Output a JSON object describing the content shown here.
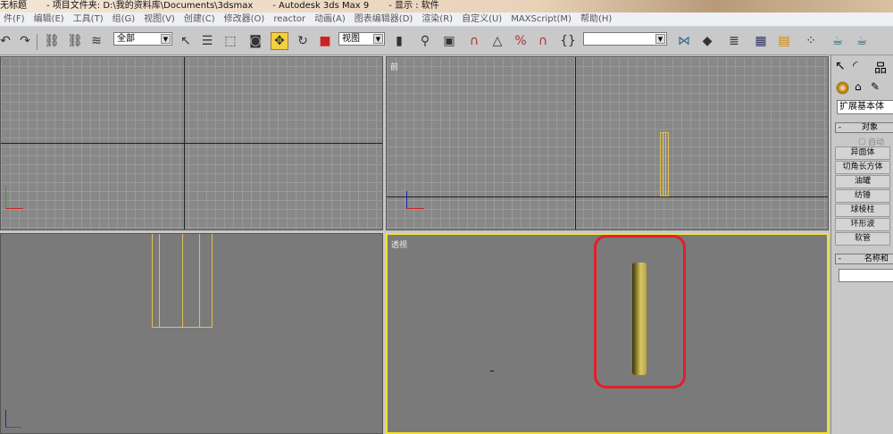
{
  "title": {
    "doc": "无标题",
    "project": "- 项目文件夹: D:\\我的资料库\\Documents\\3dsmax",
    "app": "- Autodesk 3ds Max 9",
    "display": "- 显示 : 软件"
  },
  "menu": [
    "件(F)",
    "编辑(E)",
    "工具(T)",
    "组(G)",
    "视图(V)",
    "创建(C)",
    "修改器(O)",
    "reactor",
    "动画(A)",
    "图表编辑器(D)",
    "渲染(R)",
    "自定义(U)",
    "MAXScript(M)",
    "帮助(H)"
  ],
  "toolbar": {
    "selection_filter": "全部",
    "reference_coord": "视图",
    "named_selection": ""
  },
  "viewports": {
    "top_right_label": "前",
    "bottom_right_label": "透视"
  },
  "panel": {
    "category": "扩展基本体",
    "object_type_header": "对象",
    "auto_grid": "自动",
    "buttons": [
      "异面体",
      "切角长方体",
      "油罐",
      "纺锤",
      "球棱柱",
      "环形波",
      "软管"
    ],
    "name_color_header": "名称和",
    "name_value": ""
  },
  "colors": {
    "active_viewport": "#f0e030",
    "highlight": "#e0202a",
    "object": "#c8b040"
  }
}
